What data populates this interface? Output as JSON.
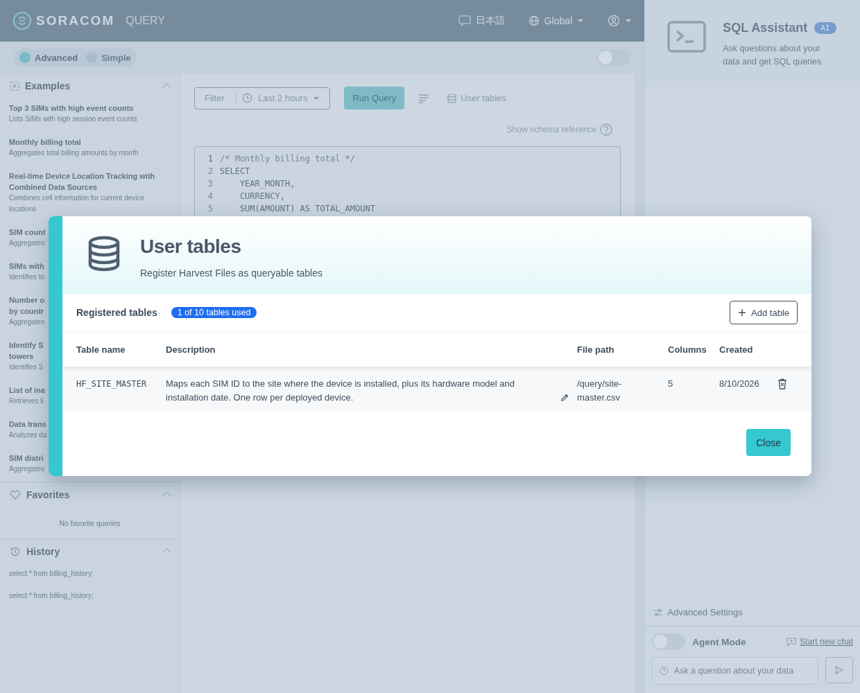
{
  "header": {
    "logo": "SORACOM",
    "product": "QUERY",
    "language": "日本語",
    "region": "Global"
  },
  "dark_mode": false,
  "mode_switch": [
    {
      "label": "Advanced",
      "selected": true
    },
    {
      "label": "Simple",
      "selected": false
    }
  ],
  "sidebar": {
    "examples": {
      "title": "Examples",
      "items": [
        {
          "title": [
            "Top 3 SIMs with high event counts"
          ],
          "description": [
            "Lists SIMs with high session event counts"
          ]
        },
        {
          "title": [
            "Monthly billing total"
          ],
          "description": [
            "Aggregates total billing amounts by month"
          ]
        },
        {
          "title": [
            "Real-time Device Location Tracking with",
            "Combined Data Sources"
          ],
          "description": [
            "Combines cell information for current device",
            "locations"
          ]
        },
        {
          "title": [
            "SIM count"
          ],
          "description": [
            "Aggregates"
          ]
        },
        {
          "title": [
            "SIMs with"
          ],
          "description": [
            "Identifies to"
          ]
        },
        {
          "title": [
            "Number o",
            "by countr"
          ],
          "description": [
            "Aggregates"
          ]
        },
        {
          "title": [
            "Identify S",
            "towers"
          ],
          "description": [
            "Identifies S"
          ]
        },
        {
          "title": [
            "List of ina"
          ],
          "description": [
            "Retrieves li"
          ]
        },
        {
          "title": [
            "Data trans"
          ],
          "description": [
            "Analyzes da"
          ]
        },
        {
          "title": [
            "SIM distri"
          ],
          "description": [
            "Aggregates"
          ]
        }
      ]
    },
    "favorites": {
      "title": "Favorites",
      "empty_text": "No favorite queries"
    },
    "history": {
      "title": "History",
      "items": [
        "select * from billing_history;",
        "select * from billing_history;"
      ]
    }
  },
  "toolbar": {
    "filter": "Filter",
    "time_range": "Last 2 hours",
    "run_button": "Run Query",
    "user_tables": "User tables",
    "schema_link": "Show schema reference"
  },
  "editor": {
    "lines": [
      {
        "number": "1",
        "code": "/* Monthly billing total */"
      },
      {
        "number": "2",
        "code": "SELECT"
      },
      {
        "number": "3",
        "code": "    YEAR_MONTH,"
      },
      {
        "number": "4",
        "code": "    CURRENCY,"
      },
      {
        "number": "5",
        "code": "    SUM(AMOUNT) AS TOTAL_AMOUNT"
      }
    ]
  },
  "assistant": {
    "title": "SQL Assistant",
    "badge": "AI",
    "description": "Ask questions about your data and get SQL queries",
    "advanced_settings": "Advanced Settings",
    "agent_mode": {
      "label": "Agent Mode",
      "on": false
    },
    "new_chat": "Start new chat",
    "input_placeholder": "Ask a question about your data"
  },
  "modal": {
    "title": "User tables",
    "subtitle": "Register Harvest Files as queryable tables",
    "section_title": "Registered tables",
    "usage_badge": "1 of 10 tables used",
    "add_button": "Add table",
    "columns": [
      "Table name",
      "Description",
      "File path",
      "Columns",
      "Created"
    ],
    "rows": [
      {
        "name": "HF_SITE_MASTER",
        "description": "Maps each SIM ID to the site where the device is installed, plus its hardware model and installation date. One row per deployed device.",
        "file_path": "/query/site-master.csv",
        "columns": "5",
        "created": "8/10/2026"
      }
    ],
    "close_button": "Close"
  }
}
